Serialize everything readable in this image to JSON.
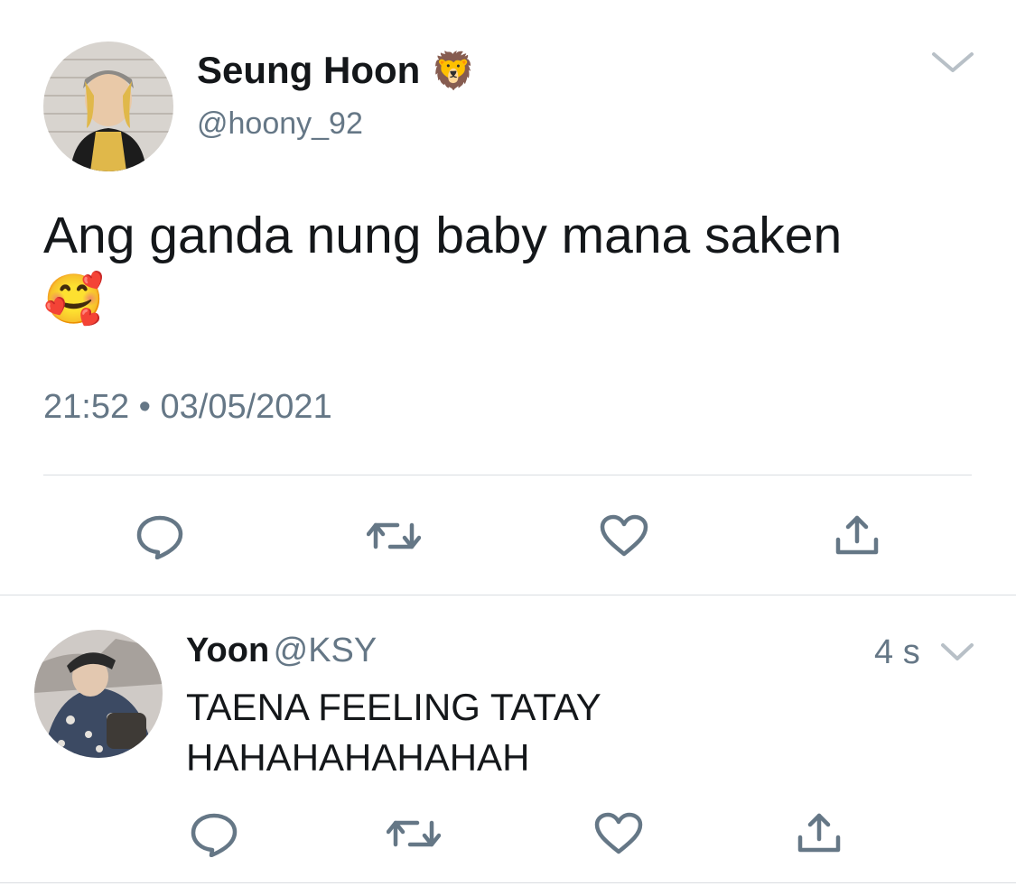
{
  "main_tweet": {
    "author": {
      "display_name": "Seung Hoon",
      "name_emoji": "🦁",
      "handle": "@hoony_92"
    },
    "text": "Ang ganda nung baby mana saken",
    "text_emoji": "🥰",
    "timestamp": "21:52 • 03/05/2021"
  },
  "reply": {
    "author": {
      "display_name": "Yoon",
      "handle": "@KSY"
    },
    "relative_time": "4 s",
    "text_line1": "TAENA FEELING TATAY",
    "text_line2": "HAHAHAHAHAHAH"
  },
  "icons": {
    "reply": "reply-bubble-icon",
    "retweet": "retweet-icon",
    "like": "heart-icon",
    "share": "share-icon",
    "menu": "chevron-down-icon"
  },
  "colors": {
    "text": "#14171a",
    "secondary": "#657786",
    "icon": "#657786",
    "divider": "#d9dde1"
  }
}
